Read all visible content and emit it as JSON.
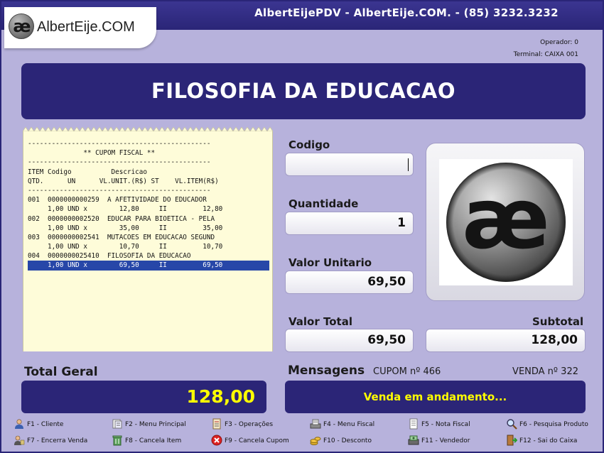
{
  "header": {
    "title": "AlbertEijePDV - AlbertEije.COM. - (85) 3232.3232",
    "logo_mark": "æ",
    "logo_text": "AlbertEije.COM"
  },
  "operator": {
    "operador": "Operador: 0",
    "terminal": "Terminal: CAIXA 001"
  },
  "product_name": "FILOSOFIA DA EDUCACAO",
  "receipt": {
    "lines": [
      "----------------------------------------------",
      "              ** CUPOM FISCAL **",
      "----------------------------------------------",
      "ITEM Codigo          Descricao",
      "QTD.      UN      VL.UNIT.(R$) ST    VL.ITEM(R$)",
      "----------------------------------------------",
      "001  0000000000259  A AFETIVIDADE DO EDUCADOR",
      "     1,00 UND x        12,80     II         12,80",
      "002  0000000002520  EDUCAR PARA BIOETICA - PELA",
      "     1,00 UND x        35,00     II         35,00",
      "003  0000000002541  MUTACOES EM EDUCACAO SEGUND",
      "     1,00 UND x        10,70     II         10,70",
      "004  0000000025410  FILOSOFIA DA EDUCACAO",
      "     1,00 UND x        69,50     II         69,50"
    ],
    "highlight_index": 13
  },
  "fields": {
    "codigo_label": "Codigo",
    "codigo_value": "",
    "quantidade_label": "Quantidade",
    "quantidade_value": "1",
    "valor_unitario_label": "Valor Unitario",
    "valor_unitario_value": "69,50",
    "valor_total_label": "Valor Total",
    "valor_total_value": "69,50",
    "subtotal_label": "Subtotal",
    "subtotal_value": "128,00"
  },
  "total": {
    "label": "Total Geral",
    "value": "128,00"
  },
  "messages": {
    "title": "Mensagens",
    "cupom": "CUPOM nº 466",
    "venda": "VENDA nº 322",
    "text": "Venda em andamento..."
  },
  "function_keys": [
    {
      "label": "F1 - Cliente",
      "icon": "user-icon"
    },
    {
      "label": "F2 - Menu Principal",
      "icon": "menu-icon"
    },
    {
      "label": "F3 - Operações",
      "icon": "operations-icon"
    },
    {
      "label": "F4 - Menu Fiscal",
      "icon": "fiscal-icon"
    },
    {
      "label": "F5 - Nota Fiscal",
      "icon": "invoice-icon"
    },
    {
      "label": "F6 - Pesquisa Produto",
      "icon": "search-icon"
    },
    {
      "label": "F7 - Encerra Venda",
      "icon": "close-sale-icon"
    },
    {
      "label": "F8 - Cancela Item",
      "icon": "trash-icon"
    },
    {
      "label": "F9 - Cancela Cupom",
      "icon": "cancel-icon"
    },
    {
      "label": "F10 - Desconto",
      "icon": "coins-icon"
    },
    {
      "label": "F11 - Vendedor",
      "icon": "seller-icon"
    },
    {
      "label": "F12 - Sai do Caixa",
      "icon": "exit-icon"
    }
  ],
  "colors": {
    "background": "#b7b2dc",
    "banner": "#2b2577",
    "highlight_text": "#ffff00",
    "receipt_paper": "#fefcd9",
    "receipt_selection": "#2747a8"
  }
}
